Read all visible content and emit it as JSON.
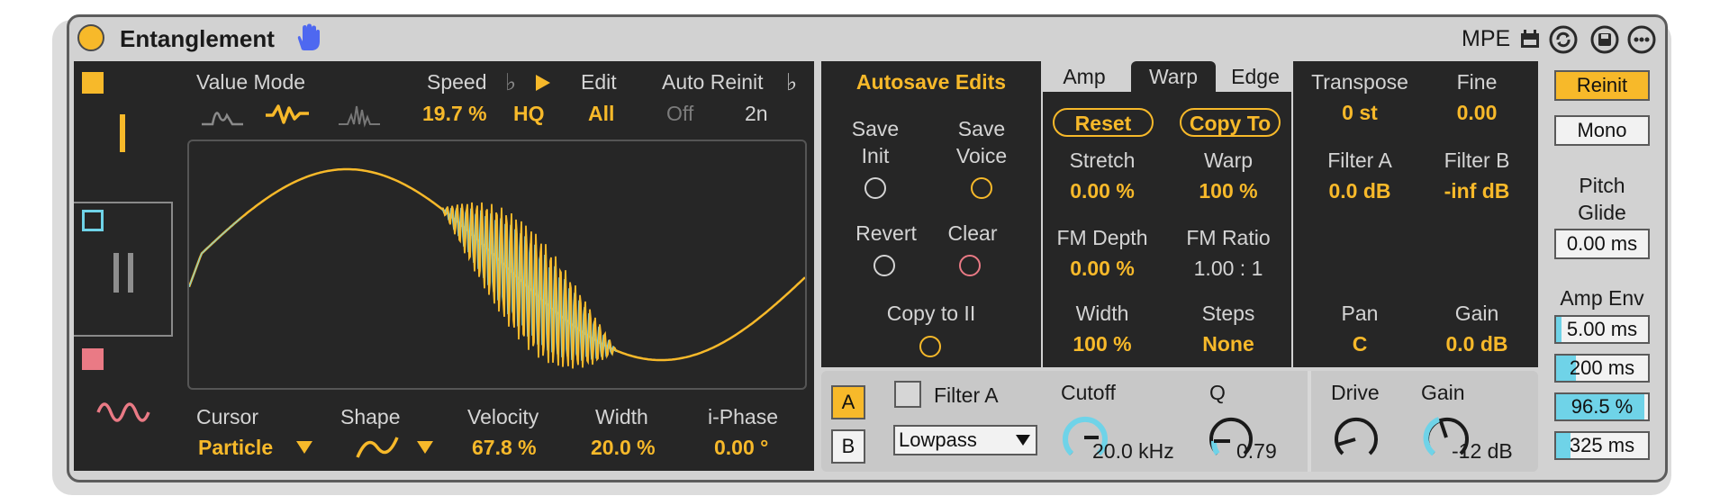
{
  "header": {
    "title": "Entanglement",
    "mpe_label": "MPE",
    "icons": [
      "power-icon",
      "hand-icon",
      "calendar-icon",
      "sync-icon",
      "save-icon",
      "more-icon"
    ]
  },
  "colors": {
    "accent": "#f7b92a",
    "cyan": "#6fd3e8",
    "pink": "#ea7a85",
    "panel_dark": "#262626",
    "panel_light": "#d2d2d2"
  },
  "oscillators": [
    {
      "glyph": "|",
      "color": "#f7b92a"
    },
    {
      "glyph": "||",
      "color": "#6fd3e8"
    },
    {
      "glyph": "wave",
      "color": "#ea7a85"
    }
  ],
  "display": {
    "value_mode_label": "Value Mode",
    "speed_label": "Speed",
    "speed_value": "19.7 %",
    "quality_value": "HQ",
    "edit_label": "Edit",
    "edit_value": "All",
    "auto_reinit_label": "Auto Reinit",
    "auto_reinit_off": "Off",
    "auto_reinit_value": "2n",
    "cursor_label": "Cursor",
    "cursor_value": "Particle",
    "shape_label": "Shape",
    "velocity_label": "Velocity",
    "velocity_value": "67.8 %",
    "width_label": "Width",
    "width_value": "20.0 %",
    "iphase_label": "i-Phase",
    "iphase_value": "0.00 °"
  },
  "voice": {
    "autosave_label": "Autosave Edits",
    "save_init_line1": "Save",
    "save_init_line2": "Init",
    "save_voice_line1": "Save",
    "save_voice_line2": "Voice",
    "revert_label": "Revert",
    "clear_label": "Clear",
    "copy_to_ii_label": "Copy to II"
  },
  "tabs": [
    {
      "label": "Amp",
      "active": false
    },
    {
      "label": "Warp",
      "active": true
    },
    {
      "label": "Edge",
      "active": false
    }
  ],
  "warp": {
    "reset_label": "Reset",
    "copy_to_label": "Copy To",
    "stretch_label": "Stretch",
    "stretch_value": "0.00 %",
    "warp_label": "Warp",
    "warp_value": "100 %",
    "fm_depth_label": "FM Depth",
    "fm_depth_value": "0.00 %",
    "fm_ratio_label": "FM Ratio",
    "fm_ratio_value": "1.00 : 1",
    "width_label": "Width",
    "width_value": "100 %",
    "steps_label": "Steps",
    "steps_value": "None"
  },
  "mix": {
    "transpose_label": "Transpose",
    "transpose_value": "0 st",
    "fine_label": "Fine",
    "fine_value": "0.00",
    "filter_a_label": "Filter A",
    "filter_a_value": "0.0 dB",
    "filter_b_label": "Filter B",
    "filter_b_value": "-inf dB",
    "pan_label": "Pan",
    "pan_value": "C",
    "gain_label": "Gain",
    "gain_value": "0.0 dB"
  },
  "filter": {
    "a_button": "A",
    "b_button": "B",
    "enable_label": "Filter A",
    "type_value": "Lowpass",
    "cutoff_label": "Cutoff",
    "cutoff_value": "20.0 kHz",
    "q_label": "Q",
    "q_value": "0.79",
    "drive_label": "Drive",
    "gain_label": "Gain",
    "gain_value": "-12 dB"
  },
  "right": {
    "reinit_label": "Reinit",
    "mono_label": "Mono",
    "pitch_line1": "Pitch",
    "pitch_line2": "Glide",
    "pitch_glide_value": "0.00 ms",
    "amp_env_label": "Amp Env",
    "env": [
      {
        "value": "5.00 ms",
        "fill": 0.06
      },
      {
        "value": "200 ms",
        "fill": 0.22
      },
      {
        "value": "96.5 %",
        "fill": 0.965
      },
      {
        "value": "325 ms",
        "fill": 0.16
      }
    ]
  }
}
